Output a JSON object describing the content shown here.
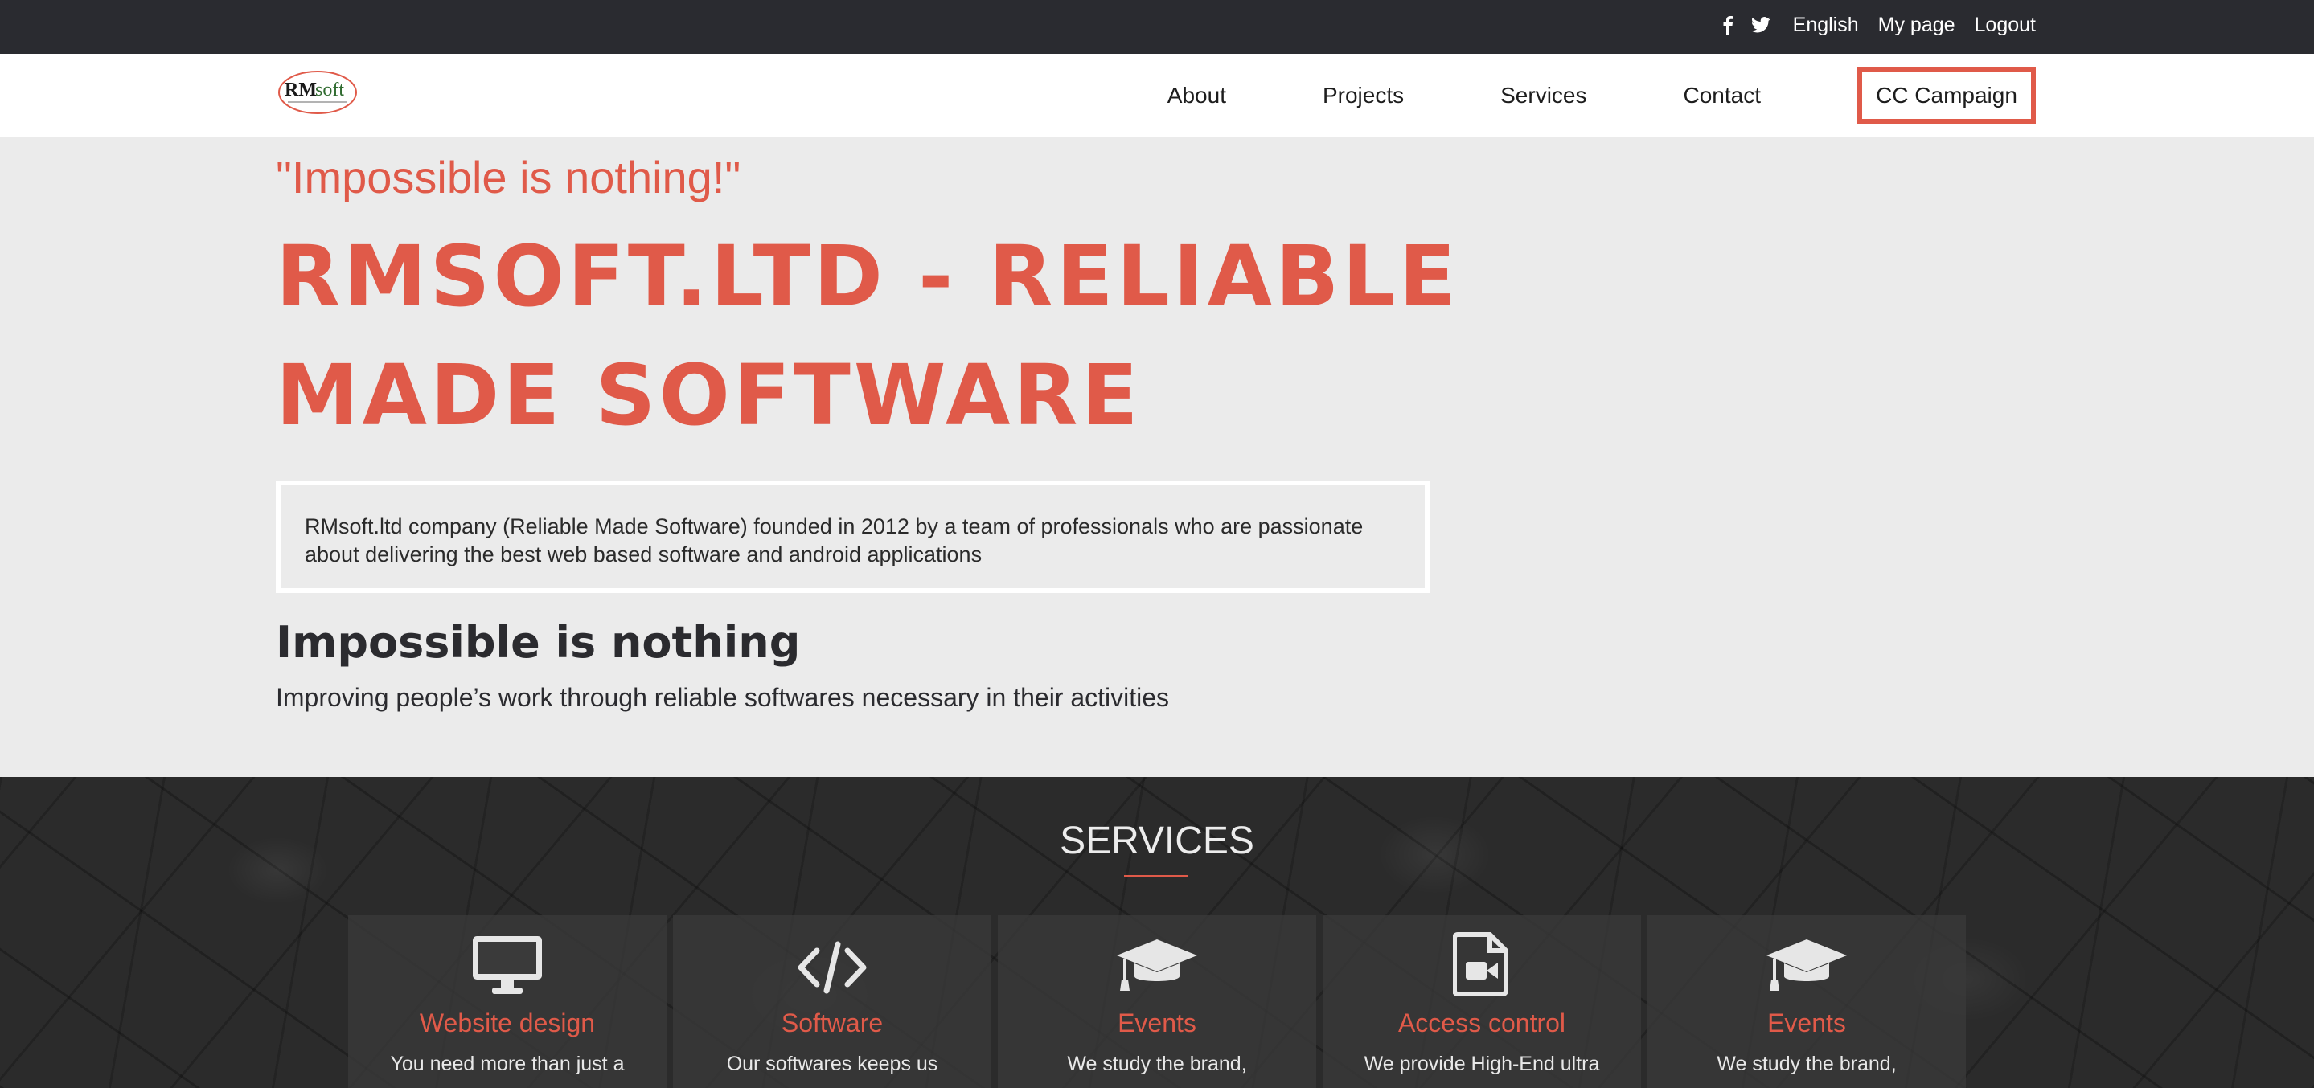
{
  "colors": {
    "accent": "#e05a49",
    "topbar_bg": "#2a2b30",
    "hero_bg": "#ebebeb",
    "dark_text": "#2b2b2f"
  },
  "topbar": {
    "icons": [
      "facebook-icon",
      "twitter-icon"
    ],
    "links": [
      "English",
      "My page",
      "Logout"
    ]
  },
  "logo": {
    "text_primary": "RM",
    "text_secondary": "soft"
  },
  "nav": {
    "items": [
      "About",
      "Projects",
      "Services",
      "Contact"
    ],
    "cta": "CC Campaign"
  },
  "hero": {
    "tagline": "\"Impossible is nothing!\"",
    "headline": "RMSOFT.LTD - RELIABLE MADE SOFTWARE",
    "intro": "RMsoft.ltd company (Reliable Made Software) founded in 2012 by a team of professionals who are passionate about delivering the best web based software and android applications",
    "subhead": "Impossible is nothing",
    "subtext": "Improving people’s work through reliable softwares necessary in their activities"
  },
  "services": {
    "title": "SERVICES",
    "cards": [
      {
        "icon": "monitor-icon",
        "title": "Website design",
        "desc": "You need more than just a"
      },
      {
        "icon": "code-icon",
        "title": "Software",
        "desc": "Our softwares keeps us"
      },
      {
        "icon": "graduation-cap-icon",
        "title": "Events",
        "desc": "We study the brand,"
      },
      {
        "icon": "video-file-icon",
        "title": "Access control",
        "desc": "We provide High-End ultra"
      },
      {
        "icon": "graduation-cap-icon",
        "title": "Events",
        "desc": "We study the brand,"
      }
    ]
  }
}
